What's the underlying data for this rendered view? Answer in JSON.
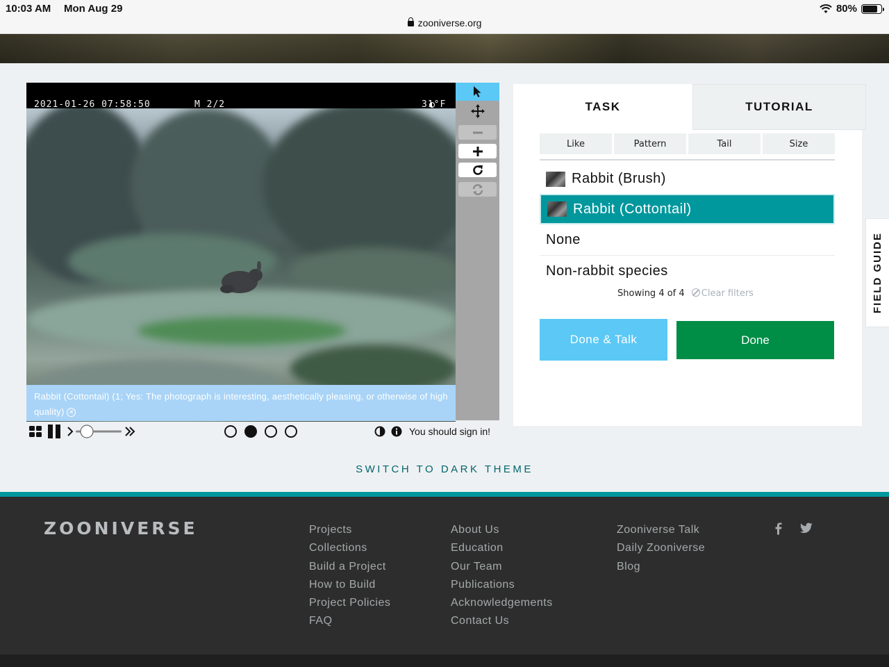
{
  "status_bar": {
    "time": "10:03 AM",
    "date": "Mon Aug 29",
    "url": "zooniverse.org",
    "battery": "80%",
    "battery_level": 0.8
  },
  "viewer": {
    "stamp_datetime": "2021-01-26 07:58:50",
    "stamp_frame": "M 2/2",
    "stamp_temp": "31°F",
    "caption_text": "Rabbit (Cottontail) (1; Yes: The photograph is interesting, aesthetically pleasing, or otherwise of high quality)",
    "frame_dots": 4,
    "current_frame": 2,
    "sign_in_text": "You should sign in!"
  },
  "toolbar": {
    "tools": [
      "pointer-icon",
      "pan-icon",
      "zoom-out-icon",
      "zoom-in-icon",
      "rotate-icon",
      "reset-icon"
    ]
  },
  "task_panel": {
    "tabs": {
      "task": "TASK",
      "tutorial": "TUTORIAL"
    },
    "filters": [
      "Like",
      "Pattern",
      "Tail",
      "Size"
    ],
    "choices": [
      {
        "label": "Rabbit (Brush)",
        "selected": false,
        "has_thumb": true
      },
      {
        "label": "Rabbit (Cottontail)",
        "selected": true,
        "has_thumb": true
      },
      {
        "label": "None",
        "selected": false,
        "has_thumb": false
      },
      {
        "label": "Non-rabbit species",
        "selected": false,
        "has_thumb": false
      }
    ],
    "showing": "Showing 4 of 4",
    "clear_filters": "Clear filters",
    "done_talk": "Done & Talk",
    "done": "Done"
  },
  "field_guide": "FIELD GUIDE",
  "switch_theme": "SWITCH TO DARK THEME",
  "footer": {
    "logo": "ZOONIVERSE",
    "col1": [
      "Projects",
      "Collections",
      "Build a Project",
      "How to Build",
      "Project Policies",
      "FAQ"
    ],
    "col2": [
      "About Us",
      "Education",
      "Our Team",
      "Publications",
      "Acknowledgements",
      "Contact Us"
    ],
    "col3": [
      "Zooniverse Talk",
      "Daily Zooniverse",
      "Blog"
    ],
    "social": [
      "facebook-icon",
      "twitter-icon"
    ]
  },
  "colors": {
    "teal": "#00979d",
    "light_blue": "#5bc8f5",
    "green": "#008d46",
    "footer": "#2d2d2d"
  }
}
